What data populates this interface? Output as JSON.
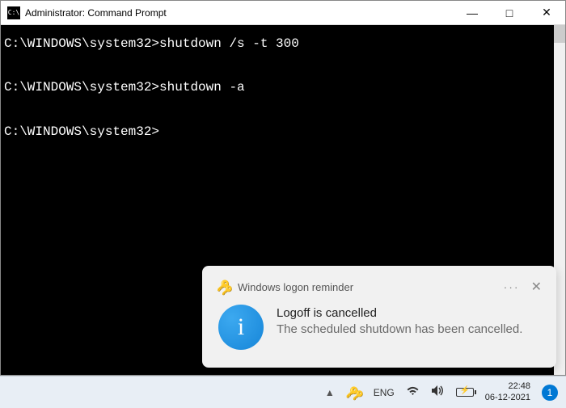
{
  "window": {
    "title": "Administrator: Command Prompt"
  },
  "terminal": {
    "lines": [
      {
        "prompt": "C:\\WINDOWS\\system32>",
        "cmd": "shutdown /s -t 300"
      },
      {
        "prompt": "C:\\WINDOWS\\system32>",
        "cmd": "shutdown -a"
      },
      {
        "prompt": "C:\\WINDOWS\\system32>",
        "cmd": ""
      }
    ]
  },
  "notification": {
    "app": "Windows logon reminder",
    "title": "Logoff is cancelled",
    "message": "The scheduled shutdown has been cancelled."
  },
  "taskbar": {
    "lang": "ENG",
    "time": "22:48",
    "date": "06-12-2021",
    "badge": "1"
  }
}
